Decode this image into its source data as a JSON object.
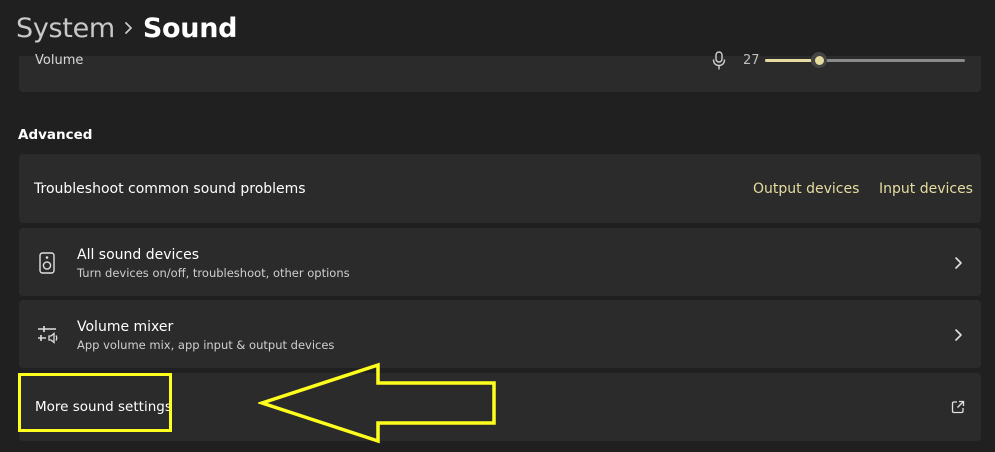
{
  "breadcrumb": {
    "parent": "System",
    "current": "Sound"
  },
  "volume": {
    "label": "Volume",
    "value": "27",
    "level_percent": 27,
    "icon": "microphone-icon"
  },
  "advanced": {
    "title": "Advanced",
    "troubleshoot": {
      "label": "Troubleshoot common sound problems",
      "links": [
        "Output devices",
        "Input devices"
      ]
    },
    "all_devices": {
      "title": "All sound devices",
      "subtitle": "Turn devices on/off, troubleshoot, other options",
      "icon": "speaker-icon"
    },
    "mixer": {
      "title": "Volume mixer",
      "subtitle": "App volume mix, app input & output devices",
      "icon": "mixer-icon"
    },
    "more": {
      "label": "More sound settings",
      "icon": "external-link-icon"
    }
  },
  "annotation": {
    "highlight_color": "#ffff1e",
    "arrow": "left-arrow"
  },
  "colors": {
    "background": "#202020",
    "card": "#2b2b2b",
    "accent": "#e6dca0"
  }
}
